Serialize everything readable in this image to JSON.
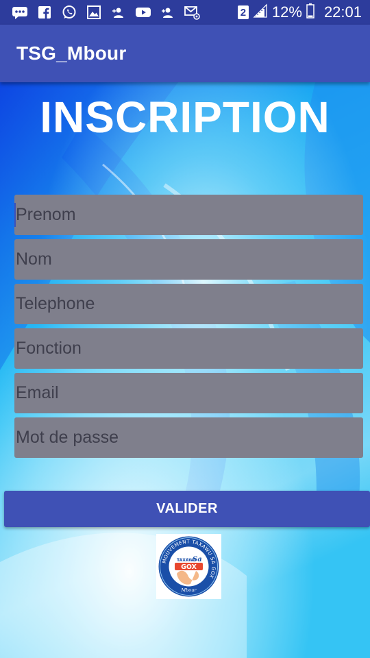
{
  "status_bar": {
    "notification_icons": [
      "message-icon",
      "facebook-icon",
      "whatsapp-icon",
      "gallery-icon",
      "person-add-icon",
      "youtube-icon",
      "person-add-icon",
      "email-icon"
    ],
    "sim_slot": "2",
    "battery_percent": "12%",
    "time": "22:01"
  },
  "app_bar": {
    "title": "TSG_Mbour"
  },
  "form": {
    "heading": "INSCRIPTION",
    "fields": [
      {
        "placeholder": "Prenom",
        "value": "",
        "focused": true
      },
      {
        "placeholder": "Nom",
        "value": ""
      },
      {
        "placeholder": "Telephone",
        "value": ""
      },
      {
        "placeholder": "Fonction",
        "value": ""
      },
      {
        "placeholder": "Email",
        "value": ""
      },
      {
        "placeholder": "Mot de passe",
        "value": ""
      }
    ],
    "submit_label": "VALIDER"
  },
  "logo": {
    "ring_text": "MOUVEMENT TAXAWU SA GOX",
    "brand_line_1": "TAXAWU",
    "brand_line_2": "Sa",
    "brand_line_3": "GOX",
    "city": "Mbour"
  },
  "colors": {
    "status_bar": "#2d3c9c",
    "primary": "#3f51b5",
    "field_background": "#7f7f8c",
    "background": "#28b8f2"
  }
}
